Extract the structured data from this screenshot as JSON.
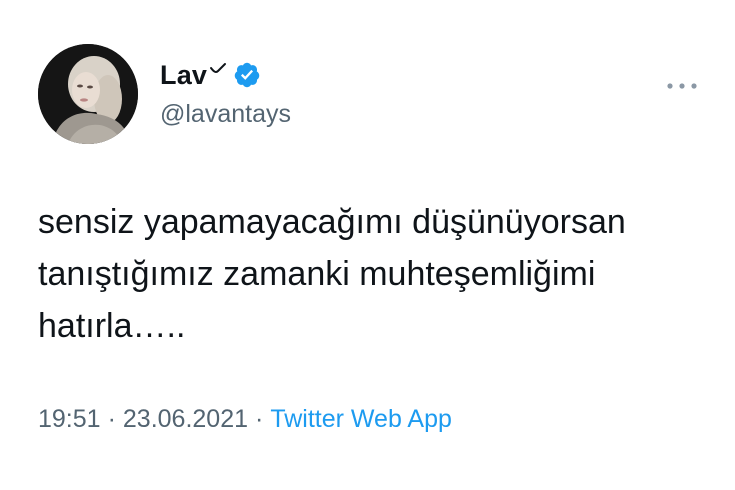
{
  "user": {
    "display_name": "Lav",
    "handle": "@lavantays",
    "verified": true,
    "avatar_icon": "profile-photo"
  },
  "tweet": {
    "text": "sensiz yapamayacağımı düşünüyorsan\ntanıştığımız zamanki muhteşemliğimi\nhatırla….."
  },
  "meta": {
    "time": "19:51",
    "separator": "·",
    "date": "23.06.2021",
    "source": "Twitter Web App"
  },
  "icons": {
    "verified": "verified-badge-icon",
    "more": "more-options-icon"
  },
  "colors": {
    "text": "#0f1419",
    "secondary": "#536471",
    "accent": "#1d9bf0"
  }
}
